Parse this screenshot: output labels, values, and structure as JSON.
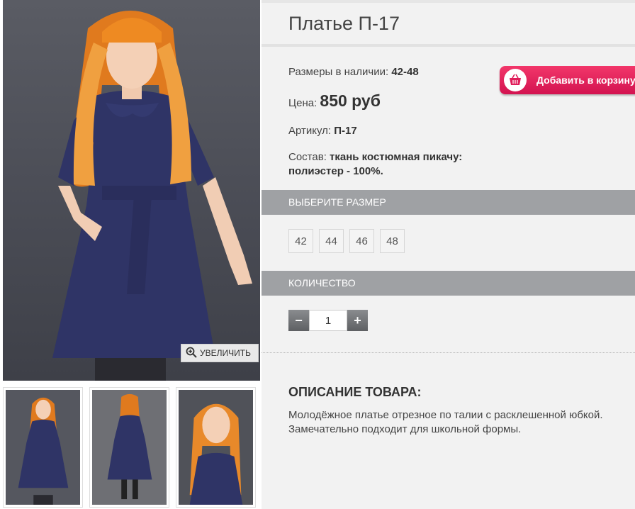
{
  "product": {
    "title": "Платье П-17",
    "sizes_label": "Размеры в наличии:",
    "sizes_value": "42-48",
    "price_label": "Цена:",
    "price_value": "850 руб",
    "sku_label": "Артикул:",
    "sku_value": "П-17",
    "composition_label": "Состав:",
    "composition_value_1": "ткань костюмная пикачу:",
    "composition_value_2": "полиэстер - 100%."
  },
  "cart": {
    "label": "Добавить в корзину",
    "icon": "basket-icon",
    "color": "#e01e5a"
  },
  "gallery": {
    "zoom_label": "УВЕЛИЧИТЬ",
    "zoom_icon": "magnifier-plus-icon"
  },
  "size_section": {
    "title": "ВЫБЕРИТЕ РАЗМЕР",
    "options": [
      "42",
      "44",
      "46",
      "48"
    ]
  },
  "quantity_section": {
    "title": "КОЛИЧЕСТВО",
    "minus": "−",
    "plus": "+",
    "value": "1"
  },
  "description": {
    "heading": "ОПИСАНИЕ ТОВАРА:",
    "line1": "Молодёжное платье отрезное по талии с расклешенной юбкой.",
    "line2": "Замечательно подходит для школьной формы."
  }
}
